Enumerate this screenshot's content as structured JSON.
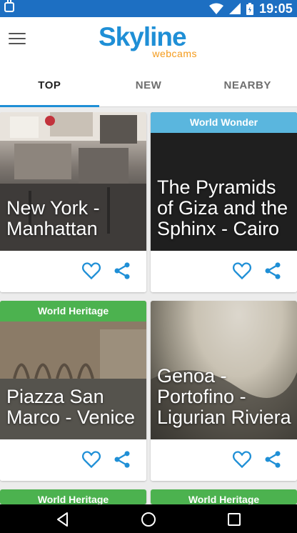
{
  "status_bar": {
    "time": "19:05",
    "icons": [
      "android-debug-icon",
      "wifi-icon",
      "signal-icon",
      "battery-icon"
    ]
  },
  "app": {
    "logo_main": "Skyline",
    "logo_sub": "webcams",
    "menu_icon": "hamburger-menu-icon"
  },
  "tabs": [
    {
      "label": "TOP",
      "active": true
    },
    {
      "label": "NEW",
      "active": false
    },
    {
      "label": "NEARBY",
      "active": false
    }
  ],
  "cards": [
    {
      "title": "New York - Manhattan",
      "badge": ""
    },
    {
      "title": "The Pyramids of Giza and the Sphinx - Cairo",
      "badge": "World Wonder"
    },
    {
      "title": "Piazza San Marco - Venice",
      "badge": "World Heritage"
    },
    {
      "title": "Genoa - Portofino - Ligurian Riviera",
      "badge": ""
    },
    {
      "title": "",
      "badge": "World Heritage"
    },
    {
      "title": "",
      "badge": "World Heritage"
    }
  ],
  "colors": {
    "status_bar": "#1d6fc2",
    "brand_blue": "#1f8fd6",
    "brand_orange": "#f49a1a",
    "badge_green": "#4cb24f",
    "badge_blue": "#5ab6de",
    "action_icon": "#1f8fd6"
  }
}
